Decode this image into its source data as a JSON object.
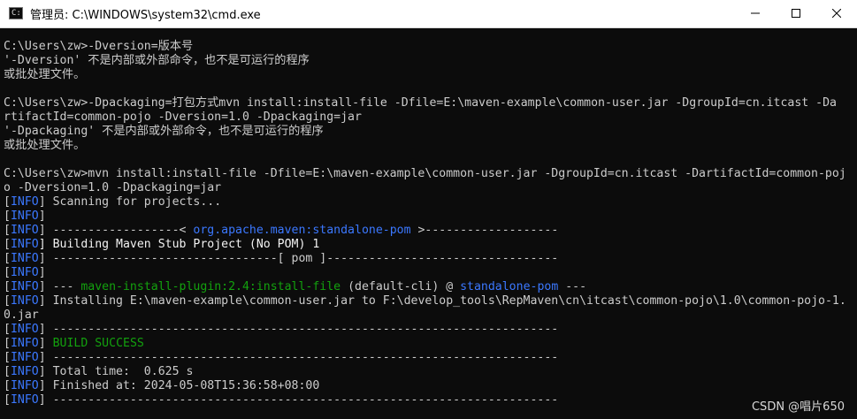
{
  "window": {
    "title": "管理员: C:\\WINDOWS\\system32\\cmd.exe",
    "app_icon": "cmd-icon",
    "controls": [
      {
        "name": "minimize-icon"
      },
      {
        "name": "maximize-icon"
      },
      {
        "name": "close-icon"
      }
    ]
  },
  "colors": {
    "console_bg": "#0c0c0c",
    "console_text": "#cccccc",
    "info_blue": "#3b78ff",
    "success_green": "#13a10e"
  },
  "console": {
    "lines": [
      [
        "C:\\Users\\zw>-Dversion=版本号"
      ],
      [
        "'-Dversion' 不是内部或外部命令，也不是可运行的程序"
      ],
      [
        "或批处理文件。"
      ],
      [
        ""
      ],
      [
        "C:\\Users\\zw>-Dpackaging=打包方式mvn install:install-file -Dfile=E:\\maven-example\\common-user.jar -DgroupId=cn.itcast -Da"
      ],
      [
        "rtifactId=common-pojo -Dversion=1.0 -Dpackaging=jar"
      ],
      [
        "'-Dpackaging' 不是内部或外部命令，也不是可运行的程序"
      ],
      [
        "或批处理文件。"
      ],
      [
        ""
      ],
      [
        "C:\\Users\\zw>mvn install:install-file -Dfile=E:\\maven-example\\common-user.jar -DgroupId=cn.itcast -DartifactId=common-poj"
      ],
      [
        "o -Dversion=1.0 -Dpackaging=jar"
      ],
      [
        "[",
        "INFO",
        "] Scanning for projects..."
      ],
      [
        "[",
        "INFO",
        "]"
      ],
      [
        "[",
        "INFO",
        "] ------------------< ",
        "org.apache.maven:standalone-pom",
        " >-------------------"
      ],
      [
        "[",
        "INFO",
        "] Building Maven Stub Project (No POM) 1"
      ],
      [
        "[",
        "INFO",
        "] --------------------------------[ pom ]---------------------------------"
      ],
      [
        "[",
        "INFO",
        "]"
      ],
      [
        "[",
        "INFO",
        "] --- ",
        "maven-install-plugin:2.4:install-file",
        " (default-cli) @ ",
        "standalone-pom",
        " ---"
      ],
      [
        "[",
        "INFO",
        "] Installing E:\\maven-example\\common-user.jar to F:\\develop_tools\\RepMaven\\cn\\itcast\\common-pojo\\1.0\\common-pojo-1."
      ],
      [
        "0.jar"
      ],
      [
        "[",
        "INFO",
        "] ------------------------------------------------------------------------"
      ],
      [
        "[",
        "INFO",
        "] ",
        "BUILD SUCCESS"
      ],
      [
        "[",
        "INFO",
        "] ------------------------------------------------------------------------"
      ],
      [
        "[",
        "INFO",
        "] Total time:  0.625 s"
      ],
      [
        "[",
        "INFO",
        "] Finished at: 2024-05-08T15:36:58+08:00"
      ],
      [
        "[",
        "INFO",
        "] ------------------------------------------------------------------------"
      ]
    ],
    "styles": [
      [
        "gray"
      ],
      [
        "gray"
      ],
      [
        "gray"
      ],
      [
        "gray"
      ],
      [
        "gray"
      ],
      [
        "gray"
      ],
      [
        "gray"
      ],
      [
        "gray"
      ],
      [
        "gray"
      ],
      [
        "gray"
      ],
      [
        "gray"
      ],
      [
        "gray",
        "blue",
        "gray"
      ],
      [
        "gray",
        "blue",
        "gray"
      ],
      [
        "gray",
        "blue",
        "gray",
        "blue",
        "gray"
      ],
      [
        "gray",
        "blue",
        "bright"
      ],
      [
        "gray",
        "blue",
        "gray"
      ],
      [
        "gray",
        "blue",
        "gray"
      ],
      [
        "gray",
        "blue",
        "gray",
        "green",
        "gray",
        "blue",
        "gray"
      ],
      [
        "gray",
        "blue",
        "gray"
      ],
      [
        "gray"
      ],
      [
        "gray",
        "blue",
        "gray"
      ],
      [
        "gray",
        "blue",
        "gray",
        "green"
      ],
      [
        "gray",
        "blue",
        "gray"
      ],
      [
        "gray",
        "blue",
        "gray"
      ],
      [
        "gray",
        "blue",
        "gray"
      ],
      [
        "gray",
        "blue",
        "gray"
      ]
    ]
  },
  "watermark": "CSDN @唱片650"
}
